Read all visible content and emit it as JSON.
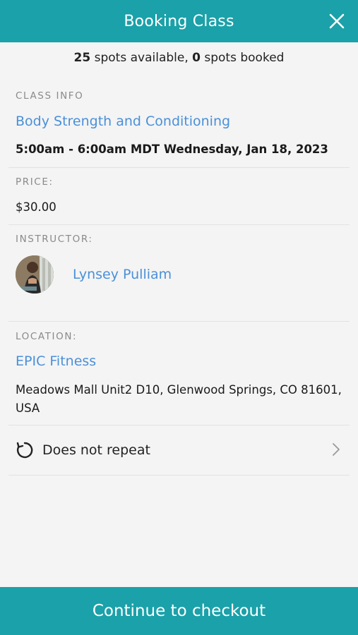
{
  "header": {
    "title": "Booking Class"
  },
  "availability": {
    "spots_available": "25",
    "spots_available_suffix": " spots available, ",
    "spots_booked": "0",
    "spots_booked_suffix": " spots booked"
  },
  "class_info": {
    "label": "CLASS INFO",
    "name": "Body Strength and Conditioning",
    "time": "5:00am - 6:00am MDT Wednesday, Jan 18, 2023"
  },
  "price": {
    "label": "PRICE:",
    "value": "$30.00"
  },
  "instructor": {
    "label": "INSTRUCTOR:",
    "name": "Lynsey Pulliam"
  },
  "location": {
    "label": "LOCATION:",
    "name": "EPIC Fitness",
    "address_line1": "Meadows Mall Unit2 D10, Glenwood Springs, CO 81601,",
    "address_line2": "USA"
  },
  "repeat": {
    "label": "Does not repeat",
    "icon": "repeat-icon"
  },
  "footer": {
    "button_label": "Continue to checkout"
  },
  "colors": {
    "accent": "#1aa1a9",
    "link": "#4a90d9"
  }
}
